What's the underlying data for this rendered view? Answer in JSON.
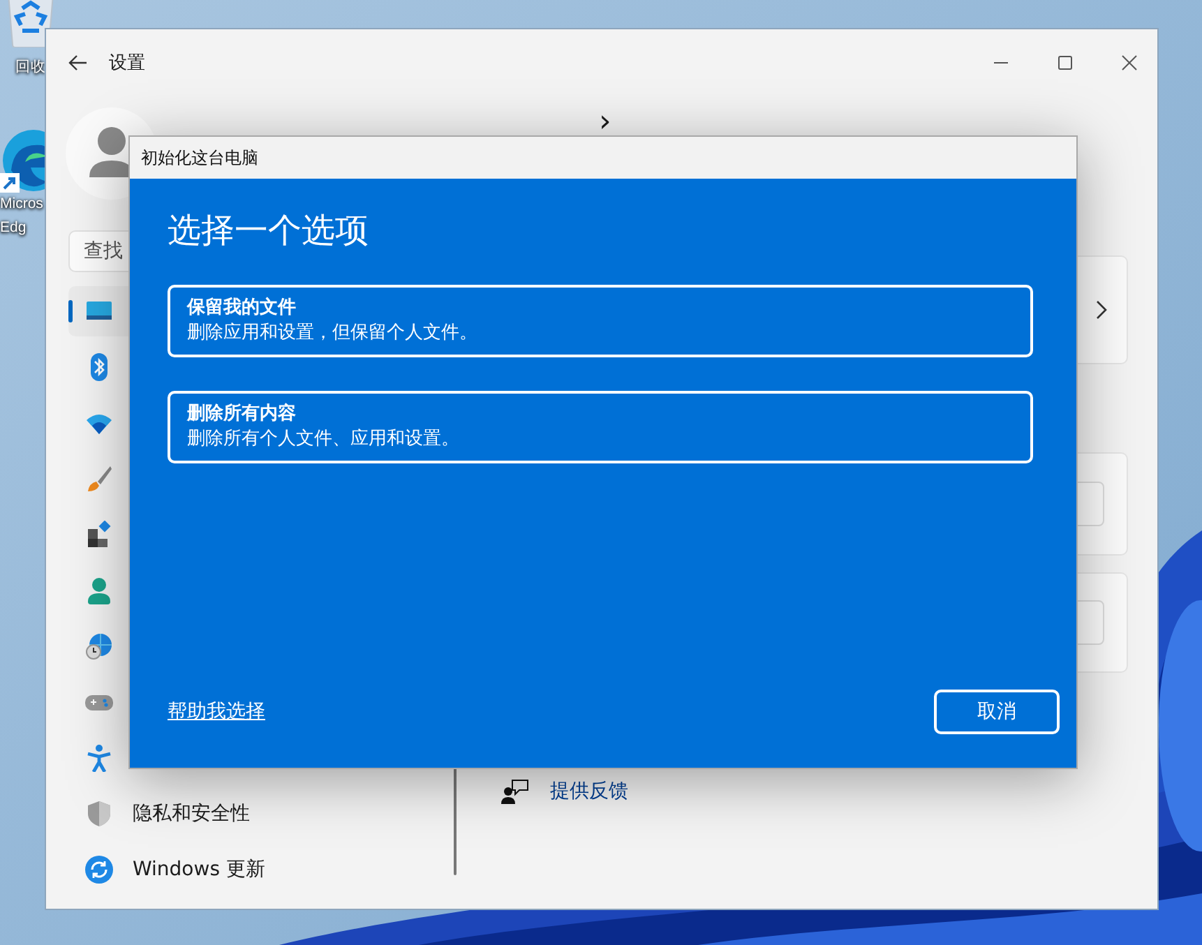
{
  "desktop": {
    "icons": [
      {
        "kind": "recycle-bin",
        "lines": [
          "回收"
        ]
      },
      {
        "kind": "browser",
        "lines": [
          "Micros",
          "Edg"
        ]
      }
    ]
  },
  "settings_window": {
    "title": "设置",
    "search": {
      "placeholder": "查找"
    },
    "breadcrumb": {
      "separator": "›"
    },
    "nav_items": [
      {
        "selected": true
      },
      {
        "selected": false
      },
      {
        "selected": false
      },
      {
        "selected": false
      },
      {
        "selected": false
      },
      {
        "selected": false
      },
      {
        "selected": false
      },
      {
        "selected": false
      },
      {
        "selected": false
      },
      {
        "selected": false,
        "label": "隐私和安全性"
      },
      {
        "selected": false,
        "label": "Windows 更新"
      }
    ],
    "feedback_link": "提供反馈"
  },
  "dialog": {
    "title": "初始化这台电脑",
    "heading": "选择一个选项",
    "options": [
      {
        "title": "保留我的文件",
        "description": "删除应用和设置，但保留个人文件。"
      },
      {
        "title": "删除所有内容",
        "description": "删除所有个人文件、应用和设置。"
      }
    ],
    "help_link": "帮助我选择",
    "cancel_button": "取消"
  }
}
